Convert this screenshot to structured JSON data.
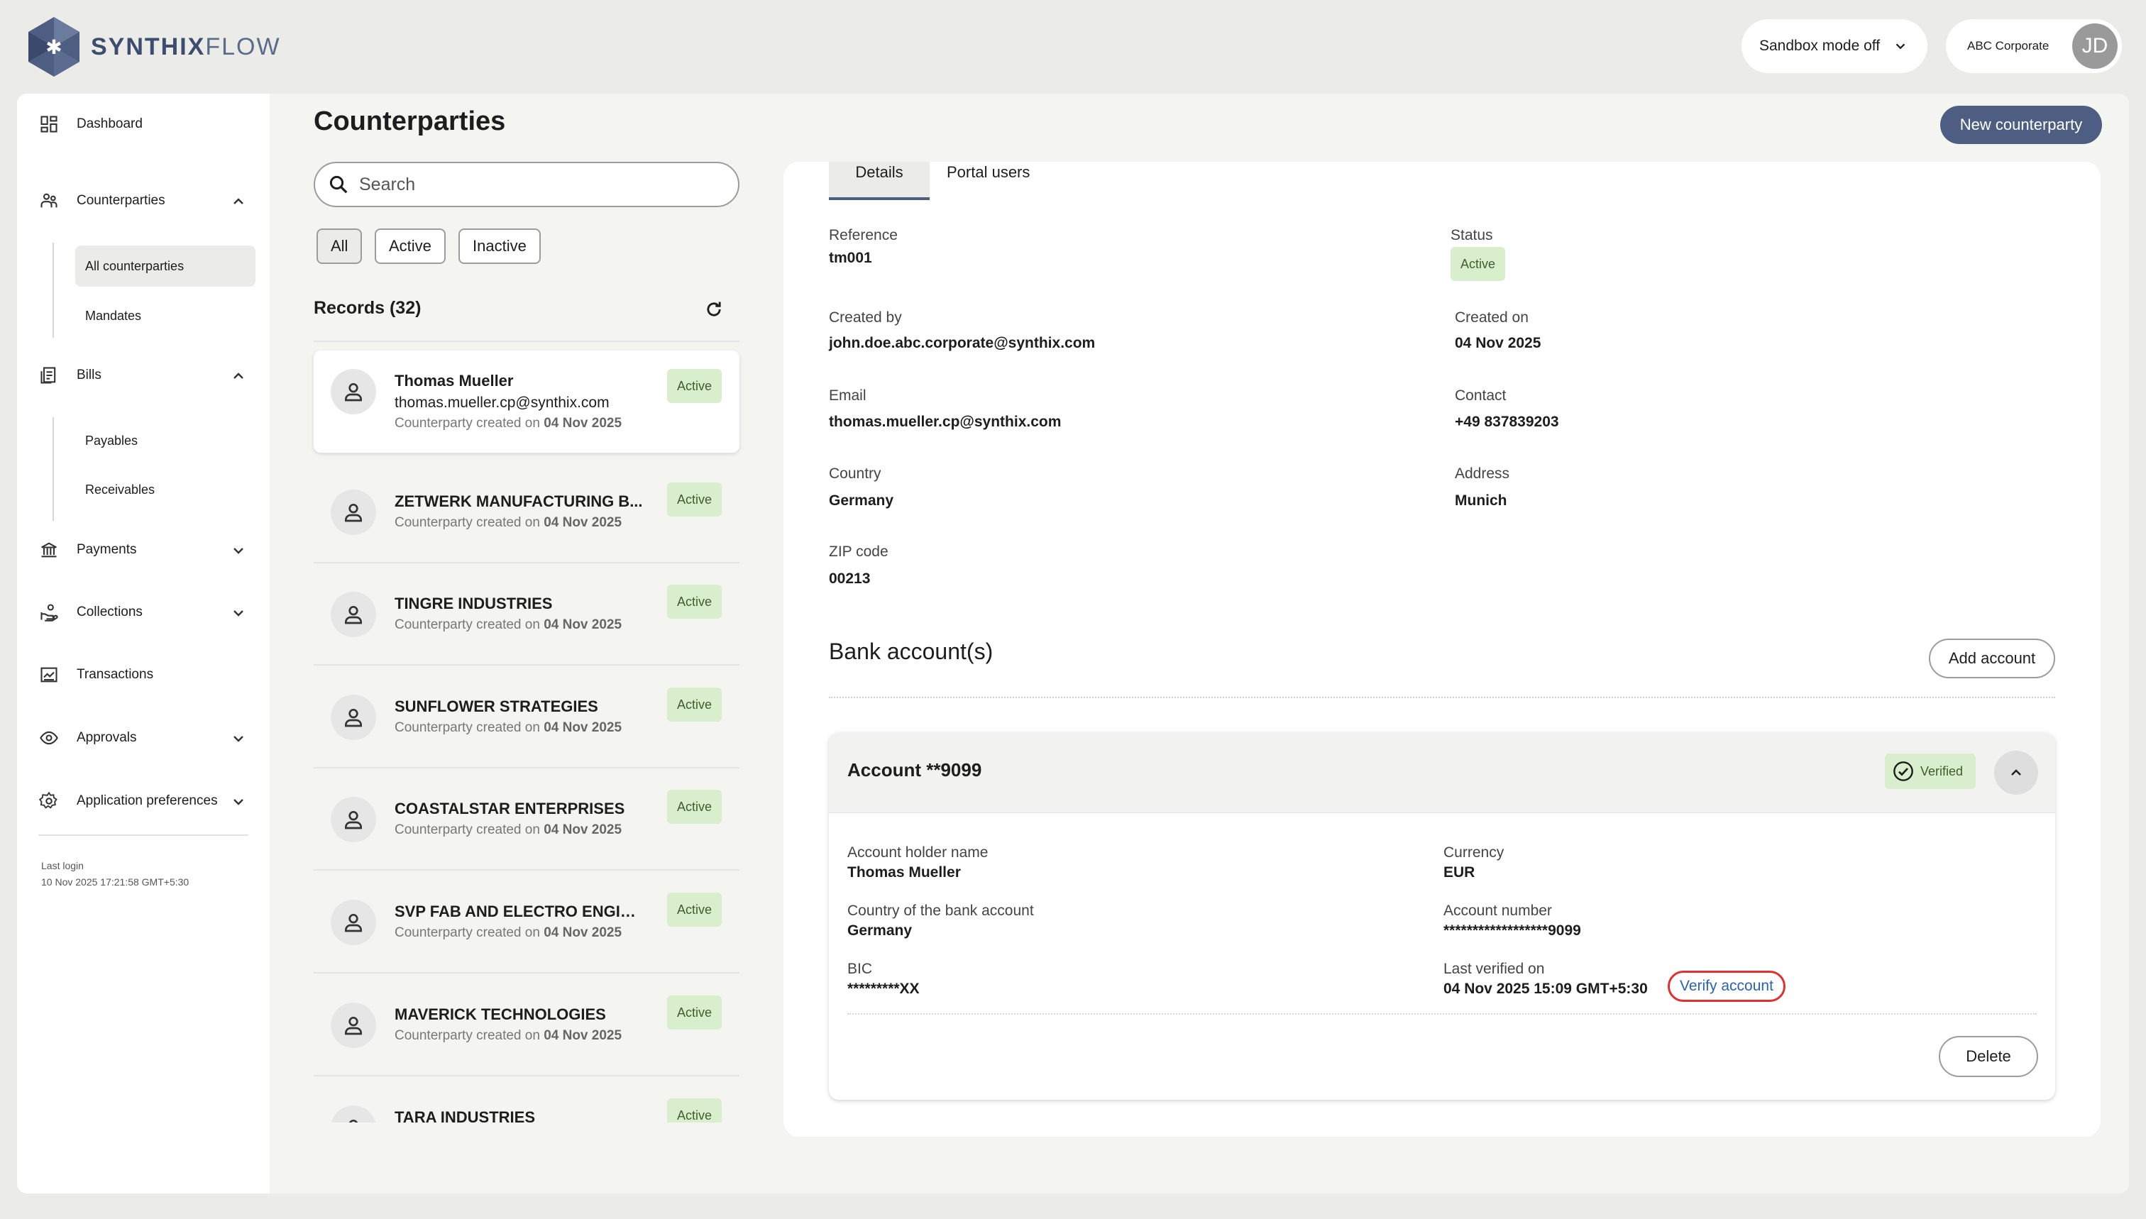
{
  "brand": {
    "name_part1": "SYNTHIX",
    "name_part2": "FLOW"
  },
  "topbar": {
    "sandbox_label": "Sandbox mode off",
    "company": "ABC Corporate",
    "avatar_initials": "JD"
  },
  "sidebar": {
    "dashboard": "Dashboard",
    "counterparties": "Counterparties",
    "all_counterparties": "All counterparties",
    "mandates": "Mandates",
    "bills": "Bills",
    "payables": "Payables",
    "receivables": "Receivables",
    "payments": "Payments",
    "collections": "Collections",
    "transactions": "Transactions",
    "approvals": "Approvals",
    "app_prefs": "Application preferences",
    "last_login_label": "Last login",
    "last_login_value": "10 Nov 2025 17:21:58 GMT+5:30"
  },
  "header": {
    "title": "Counterparties",
    "new_button": "New counterparty"
  },
  "list": {
    "search_placeholder": "Search",
    "filters": [
      "All",
      "Active",
      "Inactive"
    ],
    "records_label": "Records (32)",
    "created_prefix": "Counterparty created on",
    "items": [
      {
        "name": "Thomas Mueller",
        "email": "thomas.mueller.cp@synthix.com",
        "date": "04 Nov 2025",
        "status": "Active"
      },
      {
        "name": "ZETWERK MANUFACTURING B...",
        "date": "04 Nov 2025",
        "status": "Active"
      },
      {
        "name": "TINGRE INDUSTRIES",
        "date": "04 Nov 2025",
        "status": "Active"
      },
      {
        "name": "SUNFLOWER STRATEGIES",
        "date": "04 Nov 2025",
        "status": "Active"
      },
      {
        "name": "COASTALSTAR ENTERPRISES",
        "date": "04 Nov 2025",
        "status": "Active"
      },
      {
        "name": "SVP FAB AND ELECTRO ENGIN...",
        "date": "04 Nov 2025",
        "status": "Active"
      },
      {
        "name": "MAVERICK TECHNOLOGIES",
        "date": "04 Nov 2025",
        "status": "Active"
      },
      {
        "name": "TARA INDUSTRIES",
        "date": "",
        "status": "Active"
      }
    ]
  },
  "details": {
    "tabs": [
      "Details",
      "Portal users"
    ],
    "reference_label": "Reference",
    "reference": "tm001",
    "status_label": "Status",
    "status": "Active",
    "created_by_label": "Created by",
    "created_by": "john.doe.abc.corporate@synthix.com",
    "created_on_label": "Created on",
    "created_on": "04 Nov 2025",
    "email_label": "Email",
    "email": "thomas.mueller.cp@synthix.com",
    "contact_label": "Contact",
    "contact": "+49 837839203",
    "country_label": "Country",
    "country": "Germany",
    "address_label": "Address",
    "address": "Munich",
    "zip_label": "ZIP code",
    "zip": "00213"
  },
  "bank": {
    "section_title": "Bank account(s)",
    "add_button": "Add account",
    "account_title": "Account **9099",
    "verified_badge": "Verified",
    "holder_label": "Account holder name",
    "holder": "Thomas Mueller",
    "currency_label": "Currency",
    "currency": "EUR",
    "bank_country_label": "Country of the bank account",
    "bank_country": "Germany",
    "acc_number_label": "Account number",
    "acc_number": "******************9099",
    "bic_label": "BIC",
    "bic": "*********XX",
    "last_verified_label": "Last verified on",
    "last_verified": "04 Nov 2025 15:09 GMT+5:30",
    "verify_link": "Verify account",
    "delete_button": "Delete"
  },
  "colors": {
    "primary": "#4d5e82",
    "active_badge_bg": "#d9eecc",
    "highlight": "#e03030"
  }
}
